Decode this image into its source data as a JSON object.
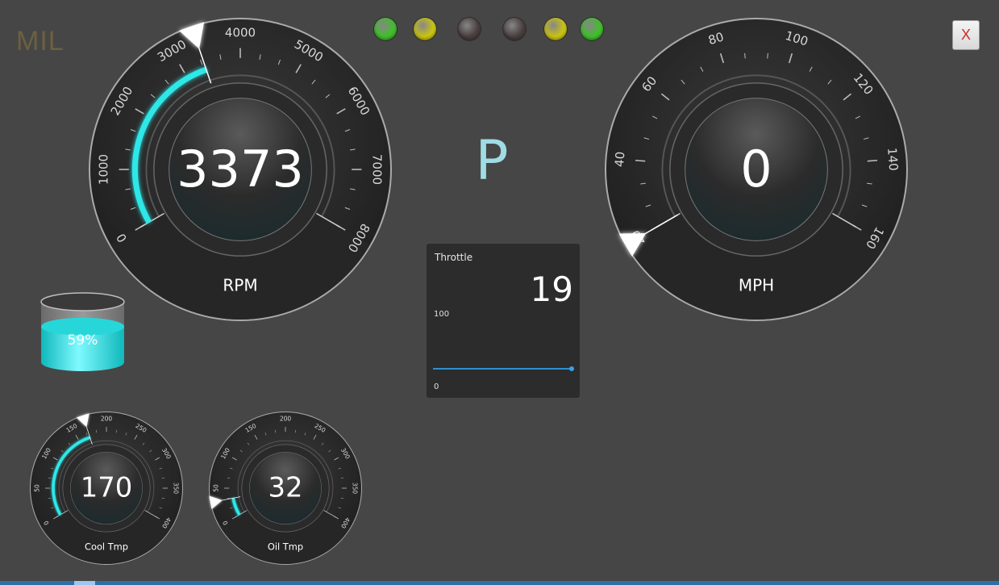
{
  "mil_label": "MIL",
  "indicator_lights": [
    {
      "name": "indicator-light-1",
      "color": "#3fbf2a"
    },
    {
      "name": "indicator-light-2",
      "color": "#c9c313"
    },
    {
      "name": "indicator-light-3",
      "color": "#4a3f3f"
    },
    {
      "name": "indicator-light-4",
      "color": "#4a3f3f"
    },
    {
      "name": "indicator-light-5",
      "color": "#c9c313"
    },
    {
      "name": "indicator-light-6",
      "color": "#3fbf2a"
    }
  ],
  "close_label": "X",
  "gear": "P",
  "accent_color": "#2ee8e8",
  "rpm": {
    "value_text": "3373",
    "value": 3373,
    "label": "RPM",
    "min": 0,
    "max": 8000,
    "ticks": [
      "0",
      "1000",
      "2000",
      "3000",
      "4000",
      "5000",
      "6000",
      "7000",
      "8000"
    ]
  },
  "speed": {
    "value_text": "0",
    "value": 0,
    "label": "MPH",
    "min": 0,
    "max": 160,
    "ticks": [
      "20",
      "40",
      "60",
      "80",
      "100",
      "120",
      "140",
      "160"
    ]
  },
  "coolant": {
    "value_text": "170",
    "value": 170,
    "label": "Cool Tmp",
    "min": 0,
    "max": 400,
    "ticks": [
      "0",
      "50",
      "100",
      "150",
      "200",
      "250",
      "300",
      "350",
      "400"
    ]
  },
  "oil": {
    "value_text": "32",
    "value": 32,
    "label": "Oil Tmp",
    "min": 0,
    "max": 400,
    "ticks": [
      "0",
      "50",
      "100",
      "150",
      "200",
      "250",
      "300",
      "350",
      "400"
    ]
  },
  "fuel": {
    "percent_text": "59%",
    "level": 0.59
  },
  "throttle": {
    "title": "Throttle",
    "value_text": "19",
    "max_label": "100",
    "min_label": "0"
  }
}
